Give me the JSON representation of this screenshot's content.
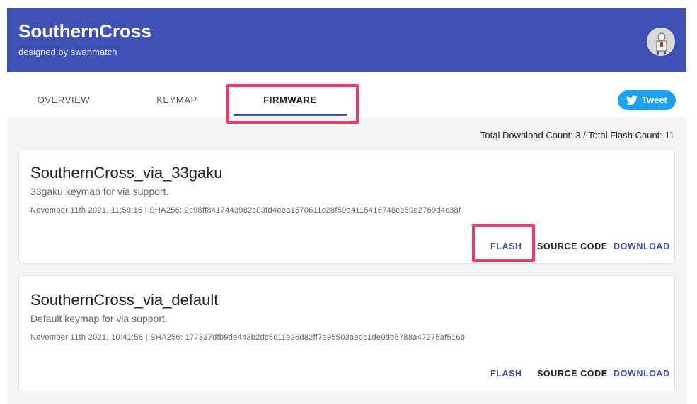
{
  "header": {
    "title": "SouthernCross",
    "subtitle": "designed by swanmatch"
  },
  "tabs": [
    {
      "label": "OVERVIEW"
    },
    {
      "label": "KEYMAP"
    },
    {
      "label": "FIRMWARE",
      "active": true
    }
  ],
  "tweet": {
    "label": "Tweet",
    "icon": "twitter-bird-icon"
  },
  "stats": {
    "text": "Total Download Count: 3 / Total Flash Count: 11"
  },
  "firmwares": [
    {
      "name": "SouthernCross_via_33gaku",
      "description": "33gaku keymap for via support.",
      "meta": "November 11th 2021, 11:59:16 | SHA256: 2c98ff8417443982c03fd4eea1570611c28f59a4115416748cb50e2769d4c38f",
      "flash": "FLASH",
      "source": "SOURCE CODE",
      "download": "DOWNLOAD"
    },
    {
      "name": "SouthernCross_via_default",
      "description": "Default keymap for via support.",
      "meta": "November 11th 2021, 10:41:58 | SHA256: 177337dfb9de443b2dc5c11e26d82ff7e95503aedc1de0de5788a47275af516b",
      "flash": "FLASH",
      "source": "SOURCE CODE",
      "download": "DOWNLOAD"
    }
  ],
  "colors": {
    "header": "#3f51b5",
    "accent": "#3f51b5",
    "highlight": "#f0386b",
    "tweet": "#1da1f2"
  }
}
